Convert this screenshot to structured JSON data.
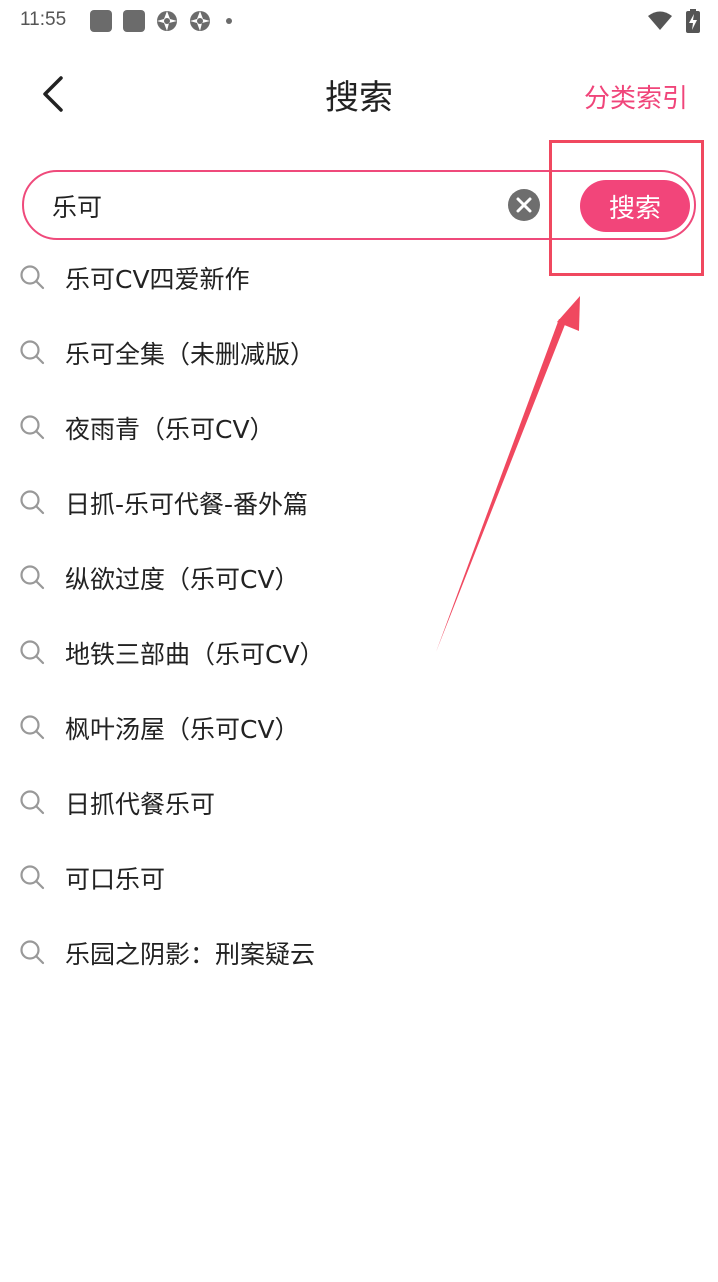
{
  "status_bar": {
    "time": "11:55"
  },
  "header": {
    "title": "搜索",
    "category_link": "分类索引",
    "back_icon": "chevron-left-icon"
  },
  "search": {
    "value": "乐可",
    "button_label": "搜索",
    "clear_icon": "close-circle-icon"
  },
  "suggestions": [
    "乐可CV四爱新作",
    "乐可全集（未删减版）",
    "夜雨青（乐可CV）",
    "日抓-乐可代餐-番外篇",
    "纵欲过度（乐可CV）",
    "地铁三部曲（乐可CV）",
    "枫叶汤屋（乐可CV）",
    "日抓代餐乐可",
    "可口乐可",
    "乐园之阴影：刑案疑云"
  ],
  "colors": {
    "accent": "#f2457a",
    "annotation": "#f0485f"
  }
}
